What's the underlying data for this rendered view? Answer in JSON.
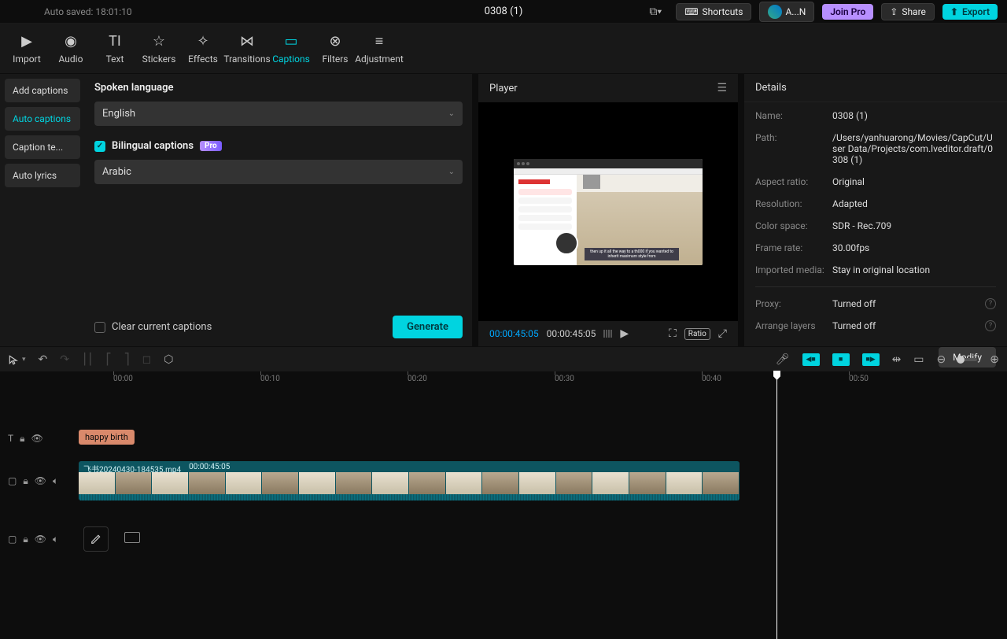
{
  "autosaved": "Auto saved: 18:01:10",
  "projectTitle": "0308 (1)",
  "topbar": {
    "shortcuts": "Shortcuts",
    "account": "A...N",
    "joinPro": "Join Pro",
    "share": "Share",
    "export": "Export"
  },
  "tooltabs": [
    "Import",
    "Audio",
    "Text",
    "Stickers",
    "Effects",
    "Transitions",
    "Captions",
    "Filters",
    "Adjustment"
  ],
  "activeTooltab": "Captions",
  "sidebar": {
    "items": [
      "Add captions",
      "Auto captions",
      "Caption te...",
      "Auto lyrics"
    ],
    "active": "Auto captions"
  },
  "captionsPanel": {
    "spokenLanguageLabel": "Spoken language",
    "spokenLanguage": "English",
    "bilingualLabel": "Bilingual captions",
    "bilingualChecked": true,
    "proBadge": "Pro",
    "secondLanguage": "Arabic",
    "clearLabel": "Clear current captions",
    "generate": "Generate"
  },
  "player": {
    "title": "Player",
    "currentTime": "00:00:45:05",
    "totalTime": "00:00:45:05",
    "ratio": "Ratio",
    "captionText": "then up it all the way to a th000 if you wanted to inherit maximum style from"
  },
  "details": {
    "title": "Details",
    "rows": {
      "nameLabel": "Name:",
      "name": "0308 (1)",
      "pathLabel": "Path:",
      "path": "/Users/yanhuarong/Movies/CapCut/User Data/Projects/com.lveditor.draft/0308 (1)",
      "aspectLabel": "Aspect ratio:",
      "aspect": "Original",
      "resLabel": "Resolution:",
      "res": "Adapted",
      "colorLabel": "Color space:",
      "color": "SDR - Rec.709",
      "frLabel": "Frame rate:",
      "fr": "30.00fps",
      "importLabel": "Imported media:",
      "import": "Stay in original location",
      "proxyLabel": "Proxy:",
      "proxy": "Turned off",
      "layersLabel": "Arrange layers",
      "layers": "Turned off"
    },
    "modify": "Modify"
  },
  "ruler": [
    "00:00",
    "00:10",
    "00:20",
    "00:30",
    "00:40",
    "00:50"
  ],
  "timeline": {
    "textClip": "happy birth",
    "videoClipName": "飞书20240430-184535.mp4",
    "videoClipDur": "00:00:45:05"
  }
}
